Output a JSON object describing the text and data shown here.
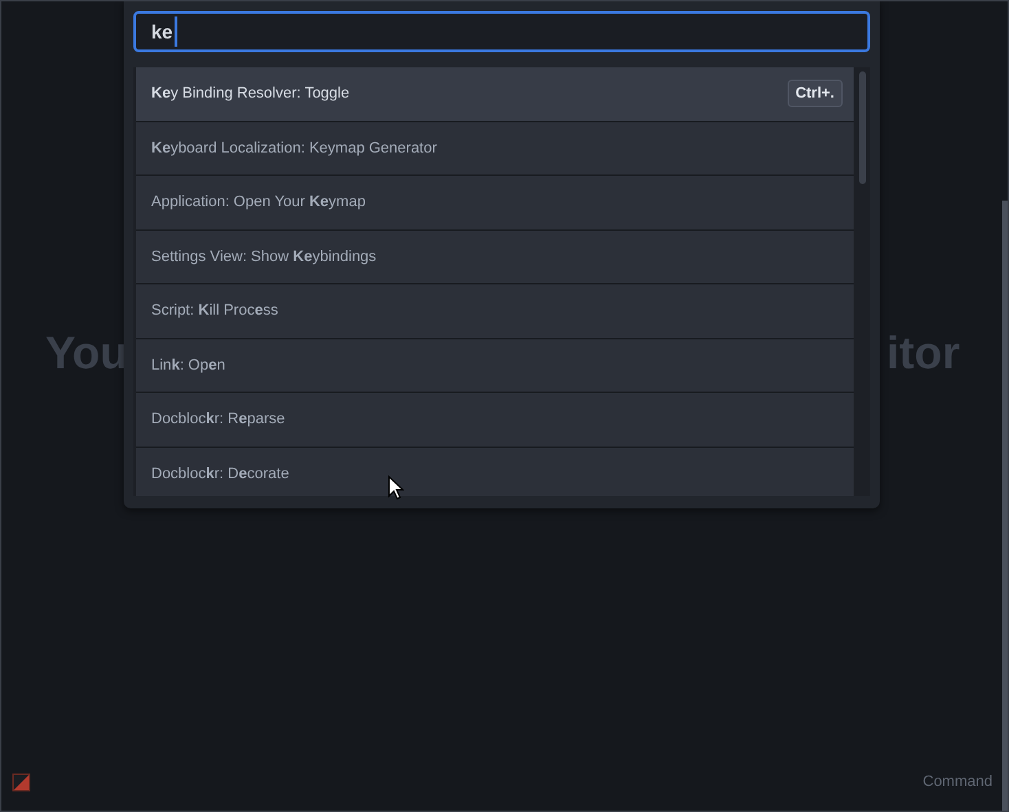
{
  "background_text": {
    "left": "You",
    "right": "itor"
  },
  "palette": {
    "query": "ke",
    "items": [
      {
        "label": "**Ke**y Binding Resolver: Toggle",
        "selected": true,
        "keybinding": "Ctrl+."
      },
      {
        "label": "**Ke**yboard Localization: Keymap Generator",
        "selected": false
      },
      {
        "label": "Application: Open Your **Ke**ymap",
        "selected": false
      },
      {
        "label": "Settings View: Show **Ke**ybindings",
        "selected": false
      },
      {
        "label": "Script: **K**ill Proc**e**ss",
        "selected": false
      },
      {
        "label": "Lin**k**: Op**e**n",
        "selected": false
      },
      {
        "label": "Docbloc**k**r: R**e**parse",
        "selected": false
      },
      {
        "label": "Docbloc**k**r: D**e**corate",
        "selected": false
      }
    ]
  },
  "status_bar": {
    "right": "Command"
  }
}
